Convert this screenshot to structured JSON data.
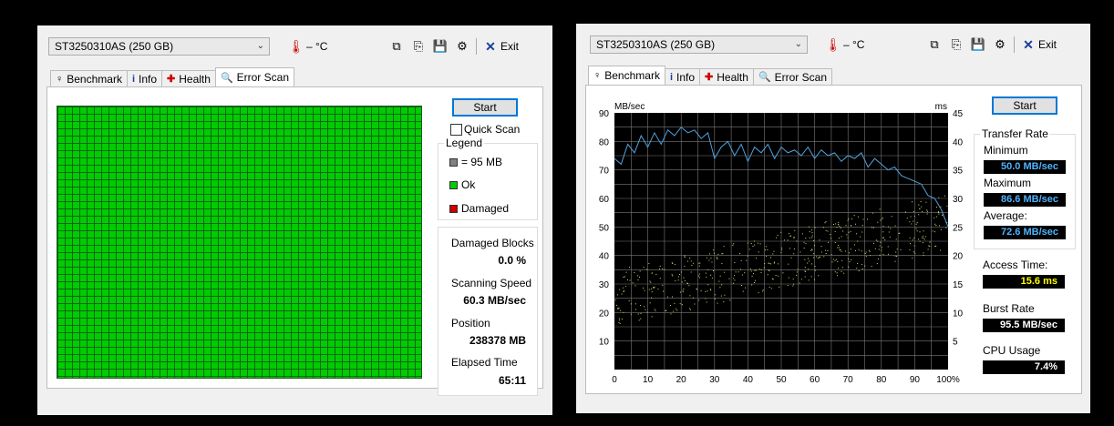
{
  "left_window": {
    "drive": "ST3250310AS (250 GB)",
    "temperature": "– °C",
    "exit_label": "Exit",
    "tabs": [
      {
        "label": "Benchmark",
        "icon": "benchmark-icon"
      },
      {
        "label": "Info",
        "icon": "info-icon"
      },
      {
        "label": "Health",
        "icon": "health-cross-icon"
      },
      {
        "label": "Error Scan",
        "icon": "magnifier-icon"
      }
    ],
    "active_tab": "Error Scan",
    "start_label": "Start",
    "quick_scan_label": "Quick Scan",
    "quick_scan_checked": false,
    "legend": {
      "title": "Legend",
      "block_size": "= 95 MB",
      "ok": "Ok",
      "damaged": "Damaged",
      "colors": {
        "block": "#808080",
        "ok": "#00cc00",
        "damaged": "#cc0000"
      }
    },
    "stats": {
      "damaged_blocks_label": "Damaged Blocks",
      "damaged_blocks_value": "0.0 %",
      "scanning_speed_label": "Scanning Speed",
      "scanning_speed_value": "60.3 MB/sec",
      "position_label": "Position",
      "position_value": "238378 MB",
      "elapsed_label": "Elapsed Time",
      "elapsed_value": "65:11"
    },
    "grid_color": "#00cc00"
  },
  "right_window": {
    "drive": "ST3250310AS (250 GB)",
    "temperature": "– °C",
    "exit_label": "Exit",
    "tabs": [
      {
        "label": "Benchmark",
        "icon": "benchmark-icon"
      },
      {
        "label": "Info",
        "icon": "info-icon"
      },
      {
        "label": "Health",
        "icon": "health-cross-icon"
      },
      {
        "label": "Error Scan",
        "icon": "magnifier-icon"
      }
    ],
    "active_tab": "Benchmark",
    "start_label": "Start",
    "transfer_rate": {
      "title": "Transfer Rate",
      "minimum_label": "Minimum",
      "minimum_value": "50.0 MB/sec",
      "maximum_label": "Maximum",
      "maximum_value": "86.6 MB/sec",
      "average_label": "Average:",
      "average_value": "72.6 MB/sec"
    },
    "access_time_label": "Access Time:",
    "access_time_value": "15.6 ms",
    "burst_rate_label": "Burst Rate",
    "burst_rate_value": "95.5 MB/sec",
    "cpu_usage_label": "CPU Usage",
    "cpu_usage_value": "7.4%"
  },
  "chart_data": {
    "type": "line",
    "y_left_label": "MB/sec",
    "y_right_label": "ms",
    "x_ticks": [
      "0",
      "10",
      "20",
      "30",
      "40",
      "50",
      "60",
      "70",
      "80",
      "90",
      "100%"
    ],
    "y_left_ticks": [
      "10",
      "20",
      "30",
      "40",
      "50",
      "60",
      "70",
      "80",
      "90"
    ],
    "y_right_ticks": [
      "5",
      "10",
      "15",
      "20",
      "25",
      "30",
      "35",
      "40",
      "45"
    ],
    "y_left_range": [
      0,
      90
    ],
    "y_right_range": [
      0,
      45
    ],
    "x_range": [
      0,
      100
    ],
    "grid": true,
    "series": [
      {
        "kind": "transfer_rate",
        "color": "#4fa3e0",
        "x": [
          0,
          2,
          4,
          6,
          8,
          10,
          12,
          14,
          16,
          18,
          20,
          22,
          24,
          26,
          28,
          30,
          32,
          34,
          36,
          38,
          40,
          42,
          44,
          46,
          48,
          50,
          52,
          54,
          56,
          58,
          60,
          62,
          64,
          66,
          68,
          70,
          72,
          74,
          76,
          78,
          80,
          82,
          84,
          86,
          88,
          90,
          92,
          94,
          96,
          98,
          100
        ],
        "y": [
          74,
          72,
          79,
          76,
          82,
          78,
          83,
          79,
          84,
          82,
          85,
          83,
          84,
          81,
          83,
          74,
          78,
          80,
          75,
          79,
          73,
          78,
          76,
          79,
          74,
          78,
          76,
          77,
          75,
          78,
          74,
          77,
          75,
          76,
          73,
          75,
          74,
          76,
          71,
          74,
          72,
          70,
          71,
          68,
          67,
          66,
          65,
          61,
          60,
          56,
          50
        ]
      },
      {
        "kind": "access_time_scatter",
        "color": "#d8d86a",
        "axis": "right",
        "trend_start_ms": 12.5,
        "trend_end_ms": 26,
        "spread_ms": 5,
        "count": 520
      }
    ]
  }
}
